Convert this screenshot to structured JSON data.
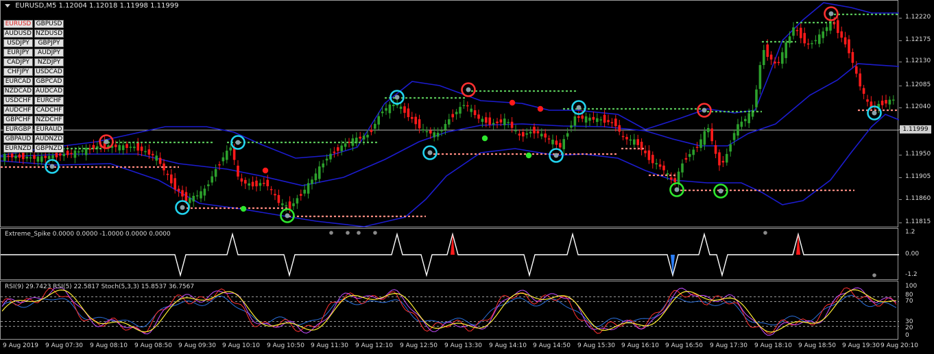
{
  "chart_header": {
    "symbol_title": "EURUSD,M5",
    "ohlc": "1.12004 1.12018 1.11998 1.11999"
  },
  "symbol_buttons": [
    [
      "EURUSD",
      "GBPUSD"
    ],
    [
      "AUDUSD",
      "NZDUSD"
    ],
    [
      "USDJPY",
      "GBPJPY"
    ],
    [
      "EURJPY",
      "AUDJPY"
    ],
    [
      "CADJPY",
      "NZDJPY"
    ],
    [
      "CHFJPY",
      "USDCAD"
    ],
    [
      "EURCAD",
      "GBPCAD"
    ],
    [
      "NZDCAD",
      "AUDCAD"
    ],
    [
      "USDCHF",
      "EURCHF"
    ],
    [
      "AUDCHF",
      "CADCHF"
    ],
    [
      "GBPCHF",
      "NZDCHF"
    ],
    [
      "EURGBP",
      "EURAUD"
    ],
    [
      "GBPAUD",
      "AUDNZD"
    ],
    [
      "EURNZD",
      "GBPNZD"
    ]
  ],
  "active_symbol": "EURUSD",
  "price_axis": [
    "1.12220",
    "1.12175",
    "1.12130",
    "1.12085",
    "1.12040",
    "1.11995",
    "1.11950",
    "1.11905",
    "1.11860",
    "1.11815"
  ],
  "current_price": "1.11999",
  "spike_indicator": {
    "label": "Extreme_Spike 0.0000 0.0000 -1.0000 0.0000 0.0000",
    "axis": [
      "1.2",
      "0.00",
      "-1.2"
    ]
  },
  "oscillator_indicator": {
    "label": "RSI(9) 29.7423  RSI(5) 22.5817  Stoch(5,3,3) 15.8537 36.7567",
    "axis": [
      "100",
      "80",
      "70",
      "30",
      "20",
      "0"
    ]
  },
  "time_axis": [
    "9 Aug 2019",
    "9 Aug 07:30",
    "9 Aug 08:10",
    "9 Aug 08:50",
    "9 Aug 09:30",
    "9 Aug 10:10",
    "9 Aug 10:50",
    "9 Aug 11:30",
    "9 Aug 12:10",
    "9 Aug 12:50",
    "9 Aug 13:30",
    "9 Aug 14:10",
    "9 Aug 14:50",
    "9 Aug 15:30",
    "9 Aug 16:10",
    "9 Aug 16:50",
    "9 Aug 17:30",
    "9 Aug 18:10",
    "9 Aug 18:50",
    "9 Aug 19:30",
    "9 Aug 20:10"
  ],
  "colors": {
    "bull": "#2ca02c",
    "bear": "#ff1a1a",
    "band": "#1c1ccf",
    "signal_cyan": "#22d3ee",
    "signal_green": "#2ee62e",
    "signal_red": "#ff3030",
    "level_green": "#58c458",
    "level_salmon": "#ff8a80"
  }
}
